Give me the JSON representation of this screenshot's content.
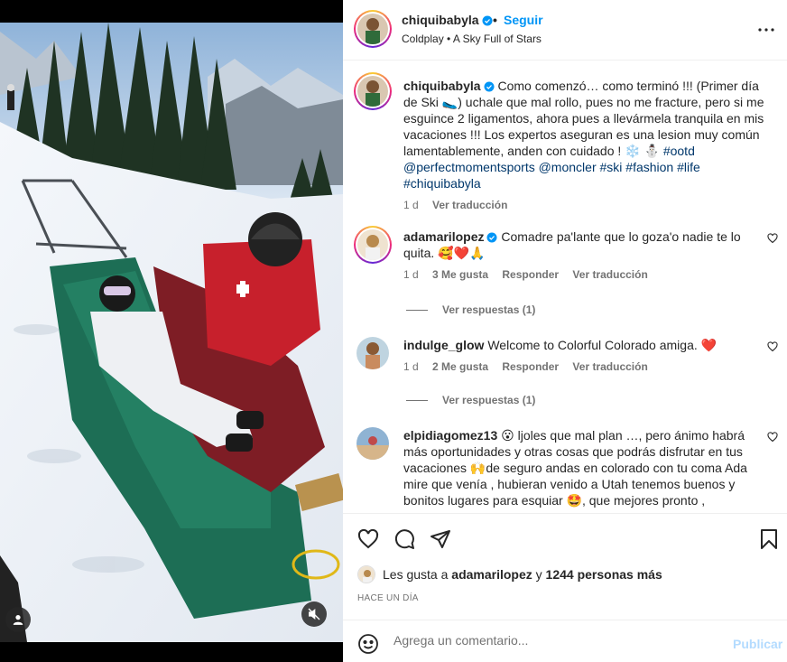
{
  "post": {
    "author": "chiquibabyla",
    "separator": "•",
    "follow_label": "Seguir",
    "song": "Coldplay • A Sky Full of Stars",
    "more_icon": "more-horizontal-icon"
  },
  "caption": {
    "username": "chiquibabyla",
    "text_1": "Como comenzó… como terminó !!! (Primer día de Ski 🥿) uchale que mal rollo, pues no me fracture, pero si me esguince 2 ligamentos, ahora pues a llevármela tranquila en mis vacaciones !!! Los expertos aseguran es una lesion muy común lamentablemente, anden con cuidado ! ❄️ ⛄ ",
    "hashtag_ootd": "#ootd",
    "tags_line": "@perfectmomentsports @moncler #ski #fashion #life",
    "hashtag_last": "#chiquibabyla",
    "time": "1 d",
    "translate": "Ver traducción"
  },
  "comments": [
    {
      "username": "adamarilopez",
      "verified": true,
      "text": "Comadre pa'lante que lo goza'o nadie te lo quita. 🥰❤️🙏",
      "time": "1 d",
      "likes": "3 Me gusta",
      "reply": "Responder",
      "translate": "Ver traducción",
      "replies": "Ver respuestas (1)"
    },
    {
      "username": "indulge_glow",
      "verified": false,
      "text": "Welcome to Colorful Colorado amiga. ❤️",
      "time": "1 d",
      "likes": "2 Me gusta",
      "reply": "Responder",
      "translate": "Ver traducción",
      "replies": "Ver respuestas (1)"
    },
    {
      "username": "elpidiagomez13",
      "verified": false,
      "text": "😮 ljoles que mal plan …, pero ánimo habrá más oportunidades y otras cosas que podrás disfrutar en tus vacaciones 🙌de seguro andas en colorado con tu coma Ada mire que venía , hubieran venido a Utah tenemos buenos y bonitos lugares para esquiar 🤩, que mejores pronto ,"
    }
  ],
  "likes": {
    "prefix": "Les gusta a",
    "user": "adamarilopez",
    "connector": "y",
    "count": "1244 personas más"
  },
  "timestamp": "HACE UN DÍA",
  "add_comment": {
    "placeholder": "Agrega un comentario...",
    "post_label": "Publicar"
  },
  "colors": {
    "accent": "#0095f6",
    "link": "#00376b",
    "secondary": "#737373",
    "post_disabled": "#b3dbff"
  }
}
